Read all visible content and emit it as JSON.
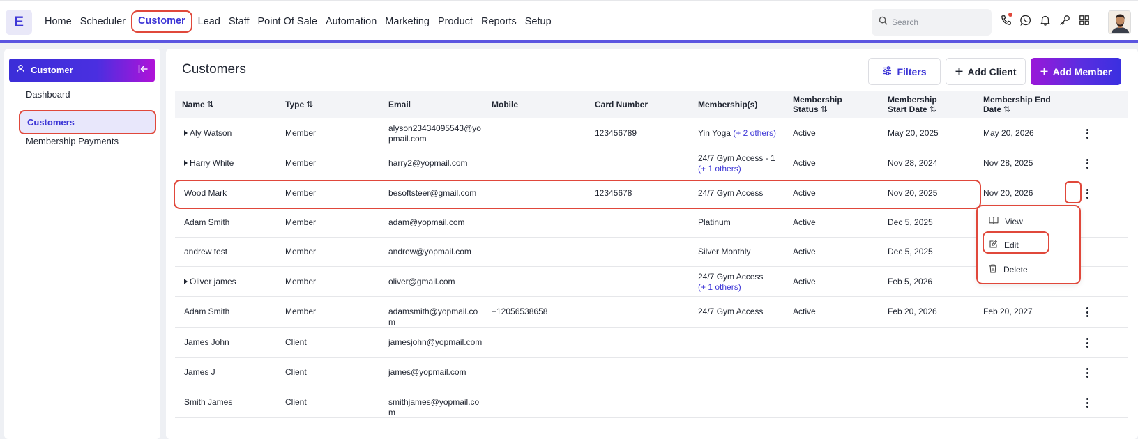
{
  "app": {
    "logo_letter": "E"
  },
  "nav": {
    "items": [
      "Home",
      "Scheduler",
      "Customer",
      "Lead",
      "Staff",
      "Point Of Sale",
      "Automation",
      "Marketing",
      "Product",
      "Reports",
      "Setup"
    ],
    "active": "Customer"
  },
  "search": {
    "placeholder": "Search"
  },
  "top_icons": [
    "phone-icon",
    "whatsapp-icon",
    "bell-icon",
    "key-icon",
    "apps-grid-icon"
  ],
  "sidebar": {
    "header": "Customer",
    "items": [
      {
        "label": "Dashboard",
        "active": false
      },
      {
        "label": "Customers",
        "active": true
      },
      {
        "label": "Membership Payments",
        "active": false
      }
    ]
  },
  "main": {
    "title": "Customers",
    "buttons": {
      "filters": "Filters",
      "add_client": "Add Client",
      "add_member": "Add Member"
    }
  },
  "table": {
    "columns": [
      {
        "label": "Name",
        "sortable": true
      },
      {
        "label": "Type",
        "sortable": true
      },
      {
        "label": "Email",
        "sortable": false
      },
      {
        "label": "Mobile",
        "sortable": false
      },
      {
        "label": "Card Number",
        "sortable": false
      },
      {
        "label": "Membership(s)",
        "sortable": false
      },
      {
        "label": "Membership Status",
        "sortable": true
      },
      {
        "label": "Membership Start Date",
        "sortable": true
      },
      {
        "label": "Membership End Date",
        "sortable": true
      }
    ],
    "rows": [
      {
        "expandable": true,
        "name": "Aly Watson",
        "type": "Member",
        "email": "alyson23434095543@yopmail.com",
        "mobile": "",
        "card": "123456789",
        "membership": "Yin Yoga",
        "membership_extra": "(+ 2 others)",
        "status": "Active",
        "start": "May 20, 2025",
        "end": "May 20, 2026"
      },
      {
        "expandable": true,
        "name": "Harry White",
        "type": "Member",
        "email": "harry2@yopmail.com",
        "mobile": "",
        "card": "",
        "membership": "24/7 Gym Access - 1",
        "membership_extra": "(+ 1 others)",
        "status": "Active",
        "start": "Nov 28, 2024",
        "end": "Nov 28, 2025"
      },
      {
        "expandable": false,
        "name": "Wood Mark",
        "type": "Member",
        "email": "besoftsteer@gmail.com",
        "mobile": "",
        "card": "12345678",
        "membership": "24/7 Gym Access",
        "membership_extra": "",
        "status": "Active",
        "start": "Nov 20, 2025",
        "end": "Nov 20, 2026"
      },
      {
        "expandable": false,
        "name": "Adam Smith",
        "type": "Member",
        "email": "adam@yopmail.com",
        "mobile": "",
        "card": "",
        "membership": "Platinum",
        "membership_extra": "",
        "status": "Active",
        "start": "Dec 5, 2025",
        "end": ""
      },
      {
        "expandable": false,
        "name": "andrew test",
        "type": "Member",
        "email": "andrew@yopmail.com",
        "mobile": "",
        "card": "",
        "membership": "Silver Monthly",
        "membership_extra": "",
        "status": "Active",
        "start": "Dec 5, 2025",
        "end": ""
      },
      {
        "expandable": true,
        "name": "Oliver james",
        "type": "Member",
        "email": "oliver@gmail.com",
        "mobile": "",
        "card": "",
        "membership": "24/7 Gym Access",
        "membership_extra": "(+ 1 others)",
        "status": "Active",
        "start": "Feb 5, 2026",
        "end": ""
      },
      {
        "expandable": false,
        "name": "Adam Smith",
        "type": "Member",
        "email": "adamsmith@yopmail.com",
        "mobile": "+12056538658",
        "card": "",
        "membership": "24/7 Gym Access",
        "membership_extra": "",
        "status": "Active",
        "start": "Feb 20, 2026",
        "end": "Feb 20, 2027"
      },
      {
        "expandable": false,
        "name": "James John",
        "type": "Client",
        "email": "jamesjohn@yopmail.com",
        "mobile": "",
        "card": "",
        "membership": "",
        "membership_extra": "",
        "status": "",
        "start": "",
        "end": ""
      },
      {
        "expandable": false,
        "name": "James J",
        "type": "Client",
        "email": "james@yopmail.com",
        "mobile": "",
        "card": "",
        "membership": "",
        "membership_extra": "",
        "status": "",
        "start": "",
        "end": ""
      },
      {
        "expandable": false,
        "name": "Smith James",
        "type": "Client",
        "email": "smithjames@yopmail.com",
        "mobile": "",
        "card": "",
        "membership": "",
        "membership_extra": "",
        "status": "",
        "start": "",
        "end": ""
      }
    ]
  },
  "row_menu": {
    "items": [
      {
        "label": "View",
        "icon": "book-icon"
      },
      {
        "label": "Edit",
        "icon": "pencil-icon"
      },
      {
        "label": "Delete",
        "icon": "trash-icon"
      }
    ]
  },
  "colors": {
    "accent": "#3d36d6",
    "highlight": "#e0483b",
    "gradient_start": "#9a17d8",
    "gradient_end": "#3a2fe0"
  }
}
